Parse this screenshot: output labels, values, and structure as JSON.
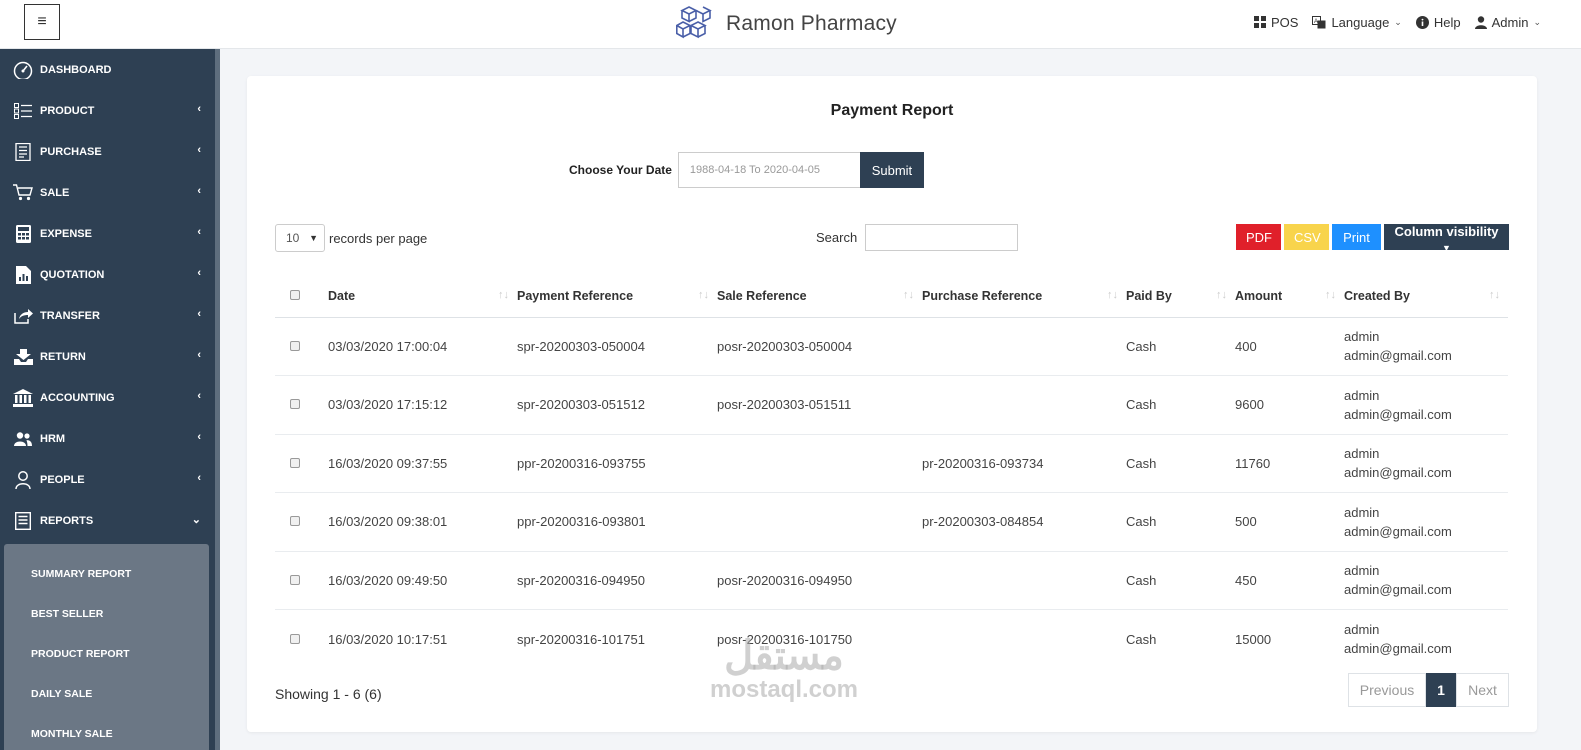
{
  "header": {
    "brand": "Ramon Pharmacy",
    "nav": {
      "pos": "POS",
      "language": "Language",
      "help": "Help",
      "admin": "Admin"
    }
  },
  "sidebar": {
    "items": [
      {
        "label": "DASHBOARD",
        "icon": "gauge-icon"
      },
      {
        "label": "PRODUCT",
        "icon": "list-icon"
      },
      {
        "label": "PURCHASE",
        "icon": "receipt-icon"
      },
      {
        "label": "SALE",
        "icon": "cart-icon"
      },
      {
        "label": "EXPENSE",
        "icon": "calculator-icon"
      },
      {
        "label": "QUOTATION",
        "icon": "document-chart-icon"
      },
      {
        "label": "TRANSFER",
        "icon": "share-icon"
      },
      {
        "label": "RETURN",
        "icon": "return-icon"
      },
      {
        "label": "ACCOUNTING",
        "icon": "bank-icon"
      },
      {
        "label": "HRM",
        "icon": "users-icon"
      },
      {
        "label": "PEOPLE",
        "icon": "user-icon"
      },
      {
        "label": "REPORTS",
        "icon": "report-icon"
      }
    ],
    "reports_sub": [
      "SUMMARY REPORT",
      "BEST SELLER",
      "PRODUCT REPORT",
      "DAILY SALE",
      "MONTHLY SALE"
    ]
  },
  "report": {
    "title": "Payment Report",
    "date_label": "Choose Your Date",
    "date_value": "1988-04-18 To 2020-04-05",
    "submit": "Submit",
    "page_length": "10",
    "records_label": "records per page",
    "search_label": "Search",
    "buttons": {
      "pdf": "PDF",
      "csv": "CSV",
      "print": "Print",
      "column_visibility": "Column visibility"
    },
    "columns": [
      "Date",
      "Payment Reference",
      "Sale Reference",
      "Purchase Reference",
      "Paid By",
      "Amount",
      "Created By"
    ],
    "rows": [
      {
        "date": "03/03/2020 17:00:04",
        "payment_ref": "spr-20200303-050004",
        "sale_ref": "posr-20200303-050004",
        "purchase_ref": "",
        "paid_by": "Cash",
        "amount": "400",
        "created_name": "admin",
        "created_email": "admin@gmail.com"
      },
      {
        "date": "03/03/2020 17:15:12",
        "payment_ref": "spr-20200303-051512",
        "sale_ref": "posr-20200303-051511",
        "purchase_ref": "",
        "paid_by": "Cash",
        "amount": "9600",
        "created_name": "admin",
        "created_email": "admin@gmail.com"
      },
      {
        "date": "16/03/2020 09:37:55",
        "payment_ref": "ppr-20200316-093755",
        "sale_ref": "",
        "purchase_ref": "pr-20200316-093734",
        "paid_by": "Cash",
        "amount": "11760",
        "created_name": "admin",
        "created_email": "admin@gmail.com"
      },
      {
        "date": "16/03/2020 09:38:01",
        "payment_ref": "ppr-20200316-093801",
        "sale_ref": "",
        "purchase_ref": "pr-20200303-084854",
        "paid_by": "Cash",
        "amount": "500",
        "created_name": "admin",
        "created_email": "admin@gmail.com"
      },
      {
        "date": "16/03/2020 09:49:50",
        "payment_ref": "spr-20200316-094950",
        "sale_ref": "posr-20200316-094950",
        "purchase_ref": "",
        "paid_by": "Cash",
        "amount": "450",
        "created_name": "admin",
        "created_email": "admin@gmail.com"
      },
      {
        "date": "16/03/2020 10:17:51",
        "payment_ref": "spr-20200316-101751",
        "sale_ref": "posr-20200316-101750",
        "purchase_ref": "",
        "paid_by": "Cash",
        "amount": "15000",
        "created_name": "admin",
        "created_email": "admin@gmail.com"
      }
    ],
    "showing": "Showing 1 - 6 (6)",
    "pagination": {
      "previous": "Previous",
      "current": "1",
      "next": "Next"
    }
  },
  "watermark": {
    "arabic": "مستقل",
    "latin": "mostaql.com"
  },
  "colors": {
    "sidebar": "#2e4053",
    "submenu": "#6b7785",
    "pdf": "#e0202a",
    "csv": "#f8d44c",
    "print": "#1e90ff",
    "primary": "#2e4053"
  }
}
